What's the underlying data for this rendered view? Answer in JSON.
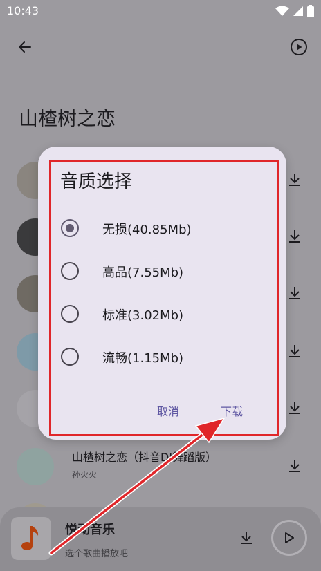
{
  "status_bar": {
    "time": "10:43"
  },
  "header": {
    "title": "山楂树之恋"
  },
  "songs": [
    {
      "title": "",
      "artist": ""
    },
    {
      "title": "",
      "artist": ""
    },
    {
      "title": "",
      "artist": ""
    },
    {
      "title": "",
      "artist": ""
    },
    {
      "title": "",
      "artist": ""
    },
    {
      "title": "山楂树之恋（抖音DJ舞蹈版）",
      "artist": "孙火火"
    },
    {
      "title": "",
      "artist": ""
    }
  ],
  "dialog": {
    "title": "音质选择",
    "options": [
      {
        "label": "无损(40.85Mb)",
        "selected": true
      },
      {
        "label": "高品(7.55Mb)",
        "selected": false
      },
      {
        "label": "标准(3.02Mb)",
        "selected": false
      },
      {
        "label": "流畅(1.15Mb)",
        "selected": false
      }
    ],
    "cancel_label": "取消",
    "download_label": "下载"
  },
  "player": {
    "title": "悦动音乐",
    "subtitle": "选个歌曲播放吧"
  },
  "colors": {
    "accent": "#625b71",
    "button_text": "#5f57a2",
    "highlight": "#e0262a",
    "dialog_bg": "#e9e4f0"
  }
}
